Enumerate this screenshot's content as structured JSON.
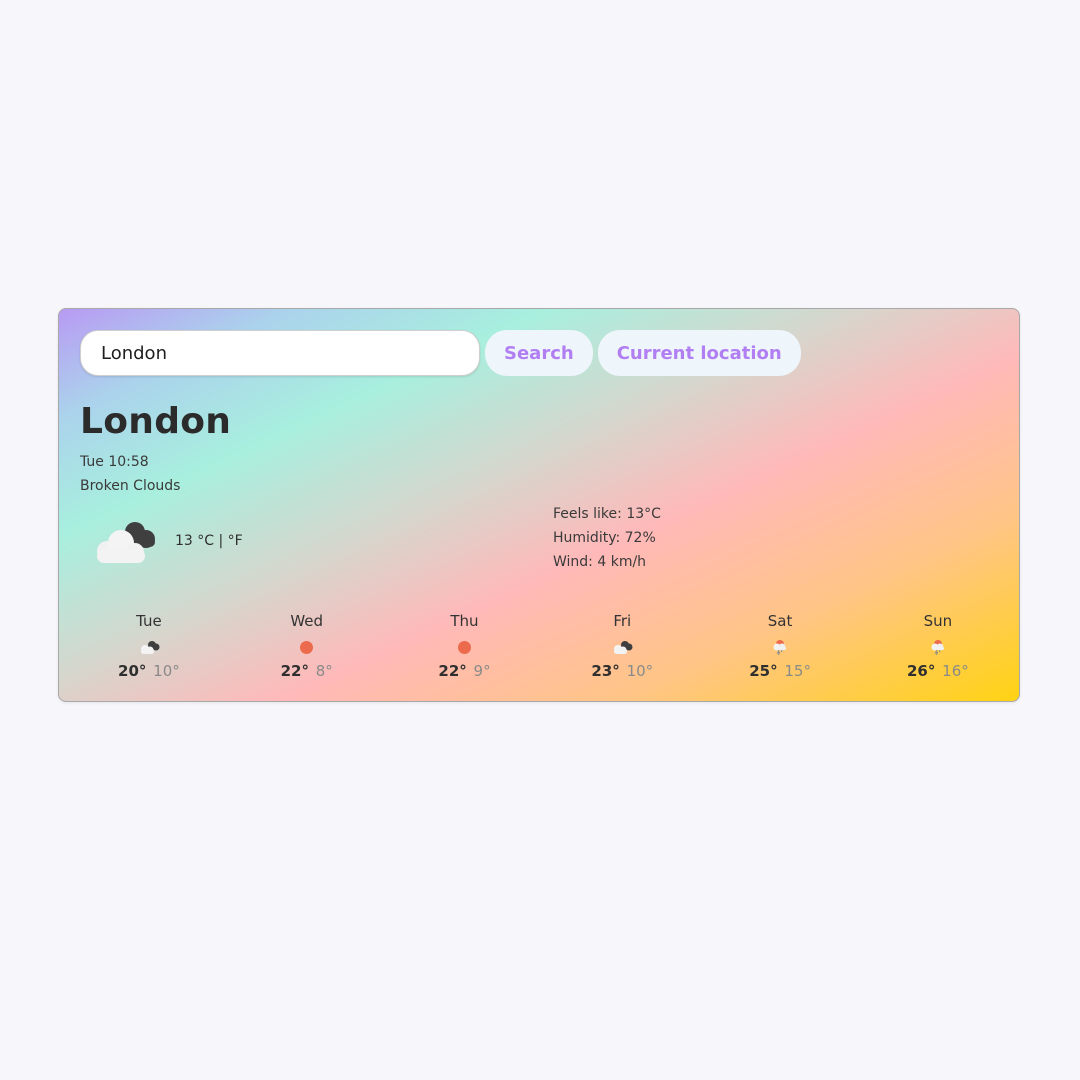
{
  "search": {
    "value": "London",
    "search_label": "Search",
    "location_label": "Current location"
  },
  "current": {
    "city": "London",
    "datetime": "Tue 10:58",
    "description": "Broken Clouds",
    "icon": "broken-clouds-icon",
    "temperature": "13",
    "units": "°C | °F",
    "feels_like": "Feels like: 13°C",
    "humidity": "Humidity: 72%",
    "wind": "Wind: 4 km/h"
  },
  "forecast": [
    {
      "day": "Tue",
      "icon": "broken-clouds-icon",
      "hi": "20°",
      "lo": "10°"
    },
    {
      "day": "Wed",
      "icon": "clear-sky-icon",
      "hi": "22°",
      "lo": "8°"
    },
    {
      "day": "Thu",
      "icon": "clear-sky-icon",
      "hi": "22°",
      "lo": "9°"
    },
    {
      "day": "Fri",
      "icon": "broken-clouds-icon",
      "hi": "23°",
      "lo": "10°"
    },
    {
      "day": "Sat",
      "icon": "thunderstorm-icon",
      "hi": "25°",
      "lo": "15°"
    },
    {
      "day": "Sun",
      "icon": "thunderstorm-icon",
      "hi": "26°",
      "lo": "16°"
    }
  ],
  "colors": {
    "accent": "#b17ff2",
    "sun": "#ec6b4d"
  }
}
